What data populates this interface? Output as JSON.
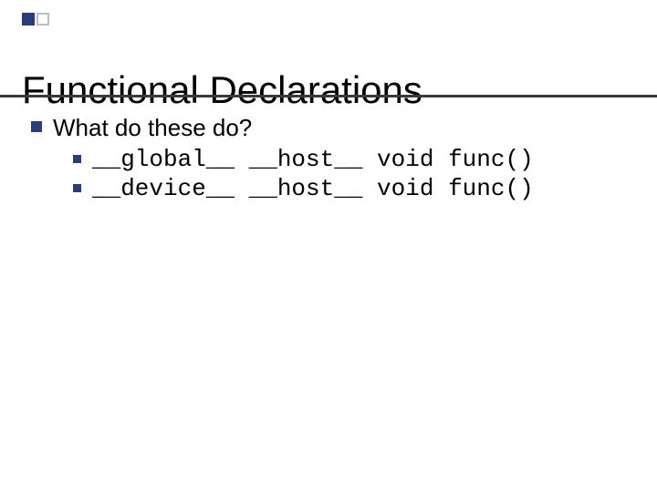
{
  "accent": {
    "solid_color": "#2a3d7a",
    "outline_color": "#b8c0cc"
  },
  "title": "Functional Declarations",
  "body": {
    "lead": "What do these do?",
    "items": [
      {
        "code": "__global__ __host__ void func()"
      },
      {
        "code": "__device__ __host__ void func()"
      }
    ]
  }
}
